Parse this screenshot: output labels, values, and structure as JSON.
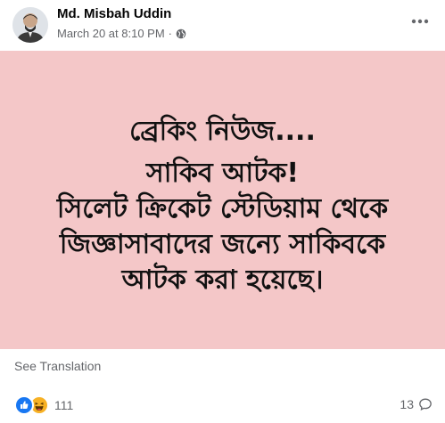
{
  "post": {
    "author": "Md. Misbah Uddin",
    "date": "March 20 at 8:10 PM",
    "separator": "·",
    "privacy_icon": "globe-icon",
    "more_icon": "more-horizontal-icon"
  },
  "image": {
    "background_color": "#f4c7c8",
    "headline": "ব্রেকিং নিউজ....",
    "lines": [
      "সাকিব আটক!",
      "সিলেট ক্রিকেট স্টেডিয়াম থেকে",
      "জিজ্ঞাসাবাদের জন্যে সাকিবকে",
      "আটক করা হয়েছে।"
    ]
  },
  "translation": {
    "label": "See Translation"
  },
  "footer": {
    "reaction_icons": [
      "like-icon",
      "haha-icon"
    ],
    "reaction_count": "111",
    "comment_count": "13",
    "comment_icon": "comment-icon"
  }
}
